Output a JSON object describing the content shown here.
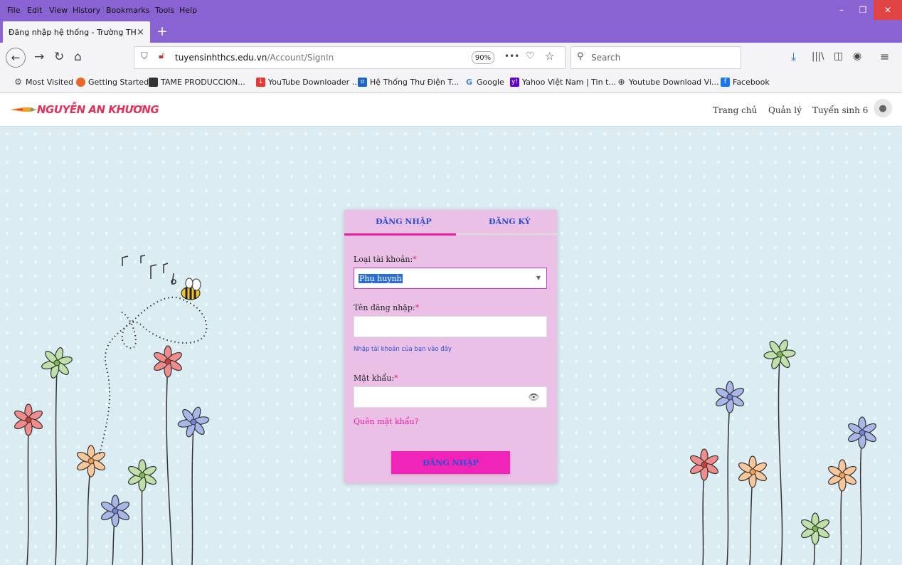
{
  "browser": {
    "menu": [
      "File",
      "Edit",
      "View",
      "History",
      "Bookmarks",
      "Tools",
      "Help"
    ],
    "tab_title": "Đăng nhập hệ thống - Trường THC",
    "tab_close": "×",
    "new_tab": "+",
    "url_host": "tuyensinhthcs.edu.vn",
    "url_path": "/Account/SignIn",
    "zoom": "90%",
    "page_actions": "•••",
    "search_placeholder": "Search",
    "window_controls": {
      "minimize": "–",
      "maximize": "❐",
      "close": "✕"
    }
  },
  "bookmarks": [
    {
      "label": "Most Visited",
      "icon": "gear-icon"
    },
    {
      "label": "Getting Started",
      "icon": "firefox-icon"
    },
    {
      "label": "TAME PRODUCCION...",
      "icon": "tame-icon"
    },
    {
      "label": "YouTube Downloader ...",
      "icon": "download-icon"
    },
    {
      "label": "Hệ Thống Thư Điện T...",
      "icon": "outlook-icon"
    },
    {
      "label": "Google",
      "icon": "google-icon"
    },
    {
      "label": "Yahoo Việt Nam | Tin t...",
      "icon": "yahoo-icon"
    },
    {
      "label": "Youtube Download Vi...",
      "icon": "globe-icon"
    },
    {
      "label": "Facebook",
      "icon": "facebook-icon"
    }
  ],
  "site": {
    "logo_text": "NGUYỄN AN KHƯƠNG",
    "nav": [
      "Trang chủ",
      "Quản lý",
      "Tuyển sinh 6"
    ]
  },
  "login": {
    "tab_login": "ĐĂNG NHẬP",
    "tab_register": "ĐĂNG KÝ",
    "account_type_label": "Loại tài khoản:",
    "account_type_value": "Phụ huynh",
    "username_label": "Tên đăng nhập:",
    "username_value": "",
    "username_hint": "Nhập tài khoản của bạn vào đây",
    "password_label": "Mật khẩu:",
    "password_value": "",
    "required_mark": "*",
    "forgot": "Quên mật khẩu?",
    "submit": "ĐĂNG NHẬP"
  },
  "colors": {
    "browser_chrome": "#8a63d2",
    "card_bg": "#ebc0e6",
    "accent_pink": "#e91e9c",
    "link_blue": "#2a4fd4",
    "page_bg": "#dcecf3"
  }
}
